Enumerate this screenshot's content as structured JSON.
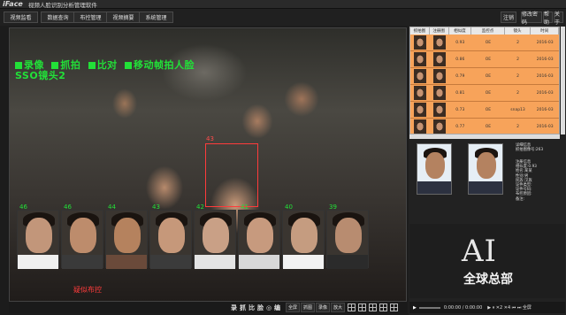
{
  "app": {
    "logo": "iFace",
    "title": "视频人脸识别分析管理软件"
  },
  "nav": {
    "items": [
      "视频监看",
      "数据查询",
      "布控管理",
      "视频摘要",
      "系统管理"
    ],
    "right": [
      "注销",
      "修改密码",
      "帮助",
      "关于"
    ]
  },
  "video": {
    "osd_line1": [
      "录像",
      "抓拍",
      "比对",
      "移动帧拍人脸"
    ],
    "osd_line2": "SSO镜头2",
    "detect_id": "43",
    "faces": [
      {
        "num": "46",
        "skin": "#c2967a",
        "shoulder": "#f0f0f0"
      },
      {
        "num": "46",
        "skin": "#bd8c6c",
        "shoulder": "#3a3a3a"
      },
      {
        "num": "44",
        "skin": "#b5825e",
        "shoulder": "#6a4a3a"
      },
      {
        "num": "43",
        "skin": "#c6987a",
        "shoulder": "#3b3b3b"
      },
      {
        "num": "42",
        "skin": "#c9a086",
        "shoulder": "#e4e4e4"
      },
      {
        "num": "41",
        "skin": "#c79a7e",
        "shoulder": "#d8d8d8"
      },
      {
        "num": "40",
        "skin": "#c59c80",
        "shoulder": "#f2f2f2"
      },
      {
        "num": "39",
        "skin": "#b88c70",
        "shoulder": "#2b2b2b"
      }
    ],
    "face_caption": "疑似布控"
  },
  "bottombar": {
    "big": [
      "录",
      "抓",
      "比",
      "脸",
      "◎",
      "编"
    ],
    "small": [
      "全屏",
      "抓图",
      "录像",
      "放大"
    ]
  },
  "table": {
    "headers": [
      "抓拍图",
      "注册图",
      "相似度",
      "监控点",
      "镜头",
      "时间"
    ],
    "rows": [
      {
        "sim": "0.93",
        "site": "OE",
        "cam": "2",
        "time": "2016-03"
      },
      {
        "sim": "0.86",
        "site": "OE",
        "cam": "2",
        "time": "2016-03"
      },
      {
        "sim": "0.79",
        "site": "OE",
        "cam": "2",
        "time": "2016-03"
      },
      {
        "sim": "0.81",
        "site": "OE",
        "cam": "2",
        "time": "2016-03"
      },
      {
        "sim": "0.73",
        "site": "OE",
        "cam": "snap13",
        "time": "2016-03"
      },
      {
        "sim": "0.77",
        "site": "OE",
        "cam": "2",
        "time": "2016-03"
      }
    ]
  },
  "compare": {
    "info_top": "详细信息\n抓拍图像号:263\n",
    "info_bottom": "注册信息\n相似度:0.93\n姓名:某某\n性别:男\n民族:汉族\n证件类型:\n证件号码:\n布控原因:\n备注:"
  },
  "branding": {
    "big": "AI",
    "sub": "全球总部"
  },
  "playbar": {
    "time": "0:00:00 / 0:00:00",
    "controls": "▶ ⏸ ✕2 ✕4 ⏮ ⏭ 全屏"
  },
  "colors": {
    "osd_green": "#22e038",
    "alert_red": "#ff3b3b",
    "table_orange": "#f7a35a"
  }
}
